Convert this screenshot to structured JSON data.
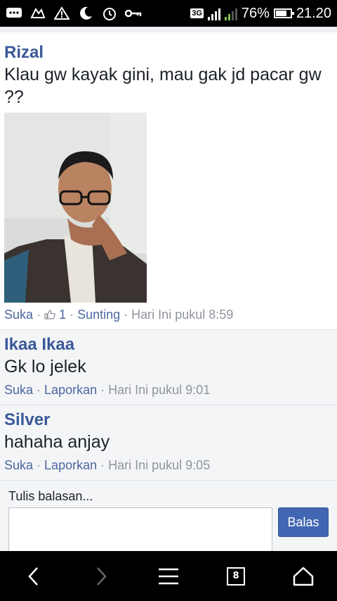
{
  "status_bar": {
    "network": "3G",
    "sim1": "1",
    "sim2": "2",
    "battery_text": "76%",
    "battery_level": 0.76,
    "time": "21.20",
    "icons": [
      "bbm-icon",
      "tweet-icon",
      "alert-icon",
      "moon-icon",
      "alarm-icon",
      "key-icon"
    ]
  },
  "post": {
    "author": "Rizal",
    "text": "Klau gw kayak gini, mau gak jd pacar gw ??",
    "like": "Suka",
    "like_count": "1",
    "edit": "Sunting",
    "time": "Hari Ini pukul 8:59"
  },
  "comments": [
    {
      "author": "Ikaa Ikaa",
      "text": "Gk lo jelek",
      "like": "Suka",
      "report": "Laporkan",
      "time": "Hari Ini pukul 9:01"
    },
    {
      "author": "Silver",
      "text": "hahaha anjay",
      "like": "Suka",
      "report": "Laporkan",
      "time": "Hari Ini pukul 9:05"
    }
  ],
  "reply": {
    "label": "Tulis balasan...",
    "button": "Balas"
  },
  "navbar": {
    "tab_count": "8"
  },
  "colors": {
    "link": "#3b5998",
    "button": "#4267b2",
    "meta": "#90949c"
  }
}
